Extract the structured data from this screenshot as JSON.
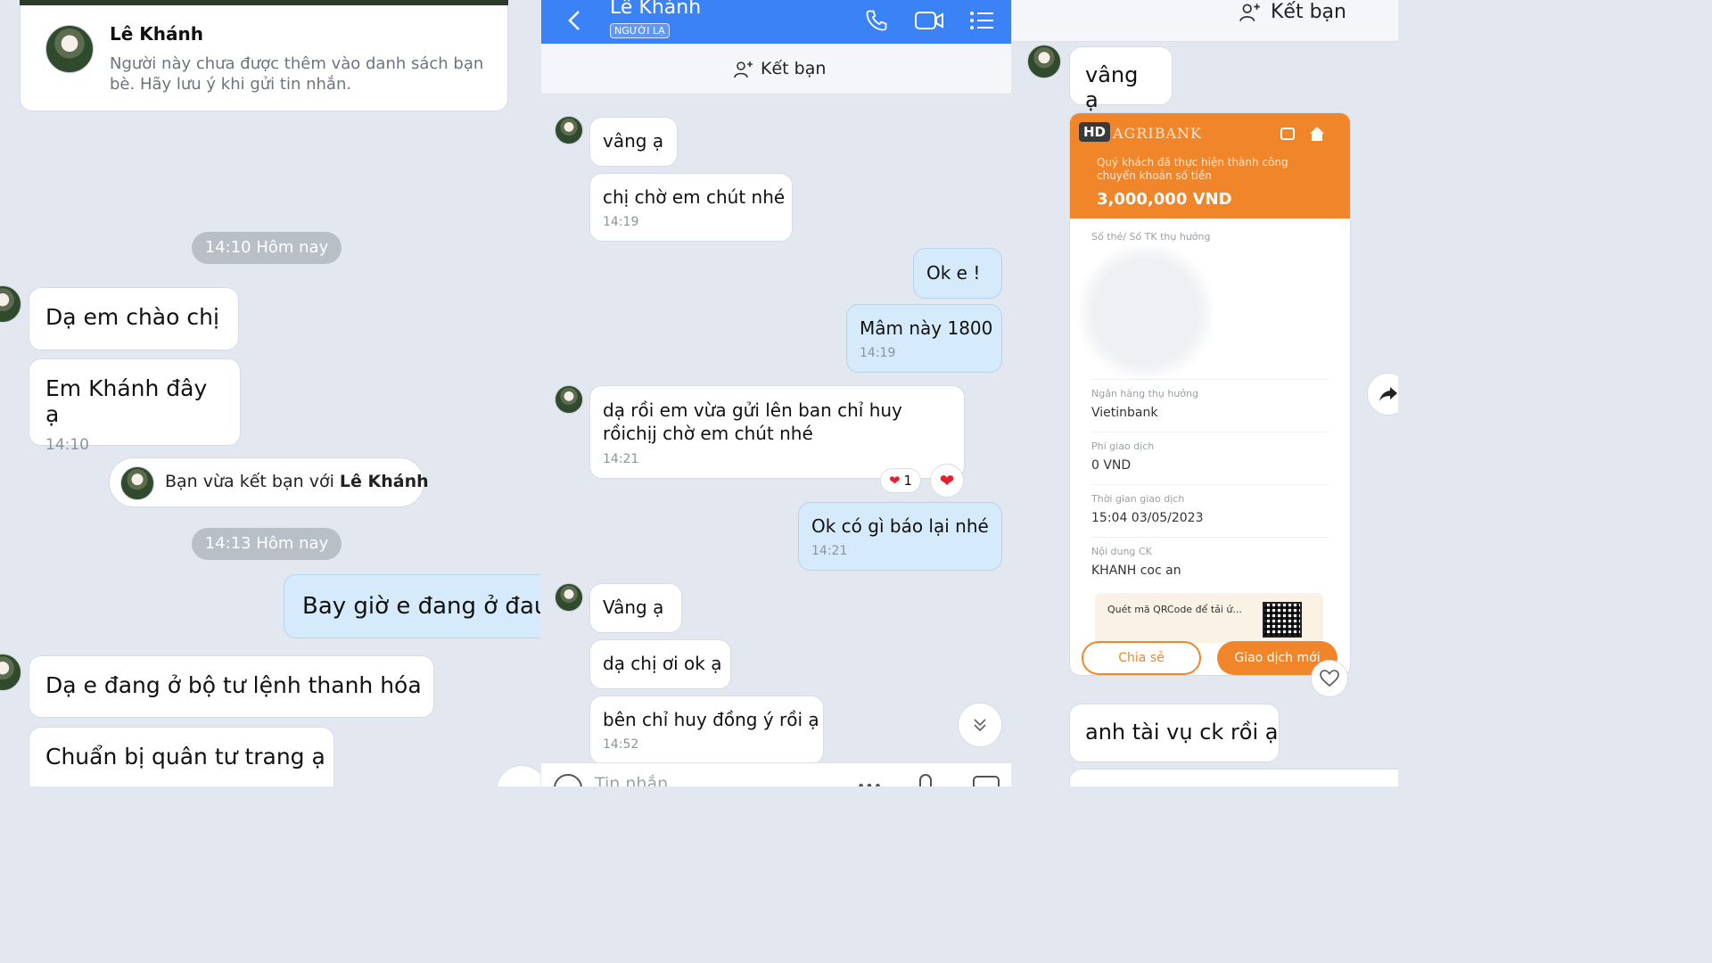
{
  "panel1": {
    "profile_name": "Lê Khánh",
    "profile_note": "Người này chưa được thêm vào danh sách bạn bè. Hãy lưu ý khi gửi tin nhắn.",
    "pill_1": "14:10 Hôm nay",
    "msg_1": "Dạ em chào chị",
    "msg_2": "Em Khánh đây ạ",
    "msg_2_time": "14:10",
    "friend_notice_prefix": "Bạn vừa kết bạn với ",
    "friend_notice_name": "Lê Khánh",
    "pill_2": "14:13 Hôm nay",
    "msg_3": "Bay giờ e đang ở đau",
    "msg_4": "Dạ e đang ở bộ tư lệnh thanh hóa",
    "msg_5": "Chuẩn bị quân tư trang ạ"
  },
  "panel2": {
    "header_name": "Lê Khánh",
    "header_badge": "NGƯỜI LẠ",
    "add_friend": "Kết bạn",
    "messages": [
      {
        "text": "vâng ạ"
      },
      {
        "text": "chị chờ em chút nhé",
        "time": "14:19"
      },
      {
        "text": "Ok e !"
      },
      {
        "text": "Mâm này 1800",
        "time": "14:19"
      },
      {
        "text": "dạ rồi em vừa gửi lên ban chỉ huy rồichịj chờ em chút nhé",
        "time": "14:21"
      },
      {
        "text": "Ok có gì báo lại nhé",
        "time": "14:21"
      },
      {
        "text": "Vâng ạ"
      },
      {
        "text": "dạ chị ơi ok ạ"
      },
      {
        "text": "bên chỉ huy đồng ý rồi ạ",
        "time": "14:52"
      }
    ],
    "reaction_count": "1",
    "input_placeholder": "Tin nhắn",
    "colors": {
      "header": "#3b82f6",
      "me_bubble": "#d5ebfb"
    }
  },
  "panel3": {
    "add_friend": "Kết bạn",
    "msg_1": "vâng ạ",
    "receipt": {
      "hd_badge": "HD",
      "bank": "AGRIBANK",
      "success_text": "Quý khách đã thực hiện thành công chuyển khoản số tiền",
      "amount": "3,000,000 VND",
      "account_label": "Số thẻ/ Số TK thụ hưởng",
      "bank_label": "Ngân hàng thụ hưởng",
      "bank_value": "Vietinbank",
      "fee_label": "Phí giao dịch",
      "fee_value": "0 VND",
      "time_label": "Thời gian giao dịch",
      "time_value": "15:04 03/05/2023",
      "content_label": "Nội dung CK",
      "content_value": "KHANH coc an",
      "qr_text": "Quét mã QRCode để tải ứ...",
      "share_button": "Chia sẻ",
      "new_tx_button": "Giao dịch mới",
      "color": "#f0852a"
    },
    "msg_2": "anh tài vụ ck rồi ạ"
  }
}
